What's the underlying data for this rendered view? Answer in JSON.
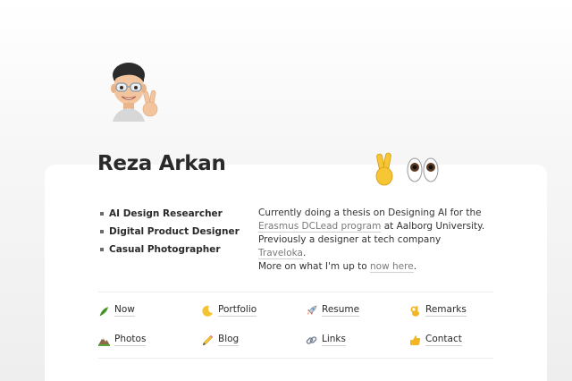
{
  "profile": {
    "name": "Reza Arkan",
    "roles": [
      "AI Design Researcher",
      "Digital Product Designer",
      "Casual Photographer"
    ],
    "bio": {
      "line1": "Currently doing a thesis on Designing AI for the",
      "program_link": "Erasmus DCLead program",
      "line2_suffix": " at Aalborg University.",
      "line3_prefix": "Previously a designer at tech company ",
      "company_link": "Traveloka",
      "line3_suffix": ".",
      "line4_prefix": "More on what I'm up to ",
      "now_link": "now here",
      "line4_suffix": "."
    }
  },
  "nav": {
    "items": [
      {
        "label": "Now",
        "icon": "herb-icon"
      },
      {
        "label": "Portfolio",
        "icon": "crescent-moon-icon"
      },
      {
        "label": "Resume",
        "icon": "rocket-icon"
      },
      {
        "label": "Remarks",
        "icon": "ok-hand-icon"
      },
      {
        "label": "Photos",
        "icon": "mountain-icon"
      },
      {
        "label": "Blog",
        "icon": "pencil-icon"
      },
      {
        "label": "Links",
        "icon": "link-icon"
      },
      {
        "label": "Contact",
        "icon": "thumbs-up-icon"
      }
    ]
  },
  "colors": {
    "link": "#7a7a7a",
    "text": "#2a2a2a",
    "background": "#f2f2f2",
    "card": "#ffffff"
  }
}
